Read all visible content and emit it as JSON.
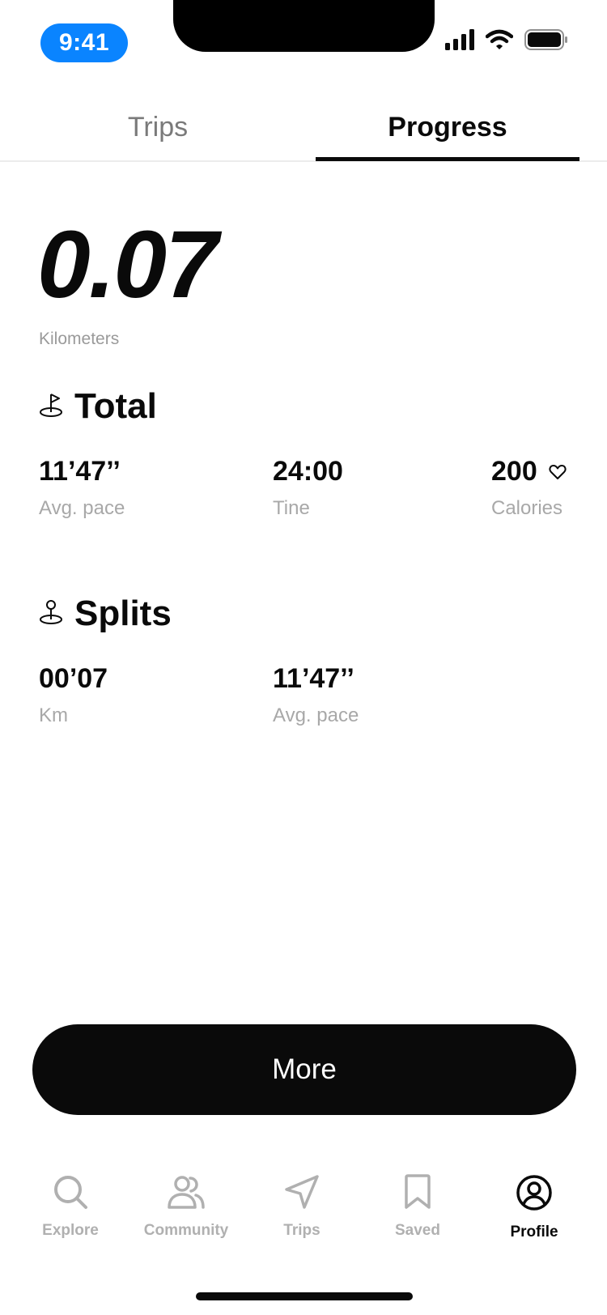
{
  "status_bar": {
    "time": "9:41"
  },
  "tabs": [
    {
      "label": "Trips",
      "active": false
    },
    {
      "label": "Progress",
      "active": true
    }
  ],
  "distance": {
    "value": "0.07",
    "unit": "Kilometers"
  },
  "total": {
    "title": "Total",
    "stats": [
      {
        "value": "11’47’’",
        "label": "Avg. pace"
      },
      {
        "value": "24:00",
        "label": "Tine"
      },
      {
        "value": "200",
        "label": "Calories",
        "icon": "heart-icon"
      }
    ]
  },
  "splits": {
    "title": "Splits",
    "stats": [
      {
        "value": "00’07",
        "label": "Km"
      },
      {
        "value": "11’47’’",
        "label": "Avg. pace"
      }
    ]
  },
  "more_button": {
    "label": "More"
  },
  "bottom_nav": [
    {
      "label": "Explore",
      "icon": "search-icon",
      "active": false
    },
    {
      "label": "Community",
      "icon": "users-icon",
      "active": false
    },
    {
      "label": "Trips",
      "icon": "navigation-icon",
      "active": false
    },
    {
      "label": "Saved",
      "icon": "bookmark-icon",
      "active": false
    },
    {
      "label": "Profile",
      "icon": "profile-icon",
      "active": true
    }
  ],
  "colors": {
    "accent": "#0a84ff",
    "primary": "#0a0a0a",
    "muted": "#a8a8a8"
  }
}
